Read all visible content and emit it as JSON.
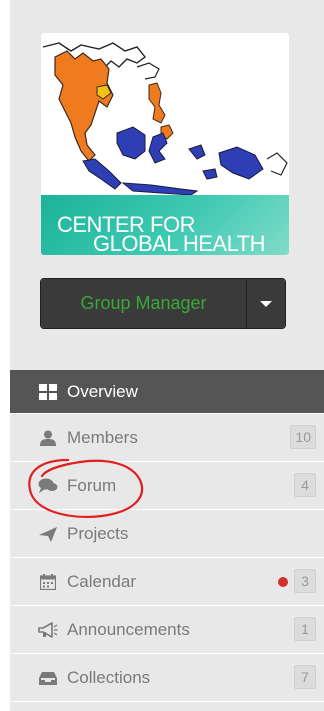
{
  "logo": {
    "line1": "CENTER FOR",
    "line2": "GLOBAL HEALTH",
    "band_color": "#1bb39a"
  },
  "group_manager": {
    "label": "Group Manager",
    "label_color": "#39a839",
    "caret_icon": "caret-down-icon"
  },
  "nav": {
    "items": [
      {
        "label": "Overview",
        "icon": "overview-grid-icon",
        "active": true
      },
      {
        "label": "Members",
        "icon": "user-icon",
        "badge": "10"
      },
      {
        "label": "Forum",
        "icon": "chat-bubbles-icon",
        "badge": "4",
        "annotated": true
      },
      {
        "label": "Projects",
        "icon": "paper-plane-icon"
      },
      {
        "label": "Calendar",
        "icon": "calendar-icon",
        "badge": "3",
        "alert_dot": true
      },
      {
        "label": "Announcements",
        "icon": "megaphone-icon",
        "badge": "1"
      },
      {
        "label": "Collections",
        "icon": "inbox-tray-icon",
        "badge": "7"
      }
    ]
  },
  "colors": {
    "sidebar_bg": "#e8e8e8",
    "active_bg": "#555555",
    "annotation_red": "#e02020",
    "alert_dot": "#d32f2f"
  }
}
